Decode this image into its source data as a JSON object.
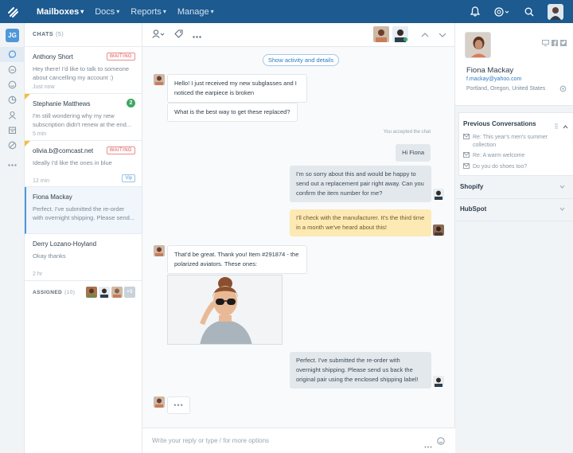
{
  "nav": {
    "items": [
      {
        "label": "Mailboxes",
        "active": true
      },
      {
        "label": "Docs",
        "active": false
      },
      {
        "label": "Reports",
        "active": false
      },
      {
        "label": "Manage",
        "active": false
      }
    ]
  },
  "rail": {
    "user_initials": "JG"
  },
  "chat_list": {
    "header": "CHATS",
    "count": "(5)",
    "chats": [
      {
        "name": "Anthony Short",
        "snippet": "Hey there! I'd like to talk to someone about cancelling my account :)",
        "time": "Just now",
        "tag": "WAITING"
      },
      {
        "name": "Stephanie Matthews",
        "snippet": "I'm still wondering why my new subscription didn't renew at the end...",
        "time": "5 min",
        "badge": "2"
      },
      {
        "name": "olivia.b@comcast.net",
        "snippet": "Ideally I'd like the ones in blue",
        "time": "12 min",
        "tag": "WAITING",
        "vip": "Vip"
      },
      {
        "name": "Fiona Mackay",
        "snippet": "Perfect. I've submitted the re-order with overnight shipping. Please send...",
        "time": ""
      },
      {
        "name": "Derry Lozano-Hoyland",
        "snippet": "Okay thanks",
        "time": "2 hr"
      }
    ],
    "assigned_label": "ASSIGNED",
    "assigned_count": "(10)",
    "assigned_more": "+5"
  },
  "conversation": {
    "activity_button": "Show activity and details",
    "accepted_line": "You accepted the chat",
    "messages": [
      {
        "from": "customer",
        "text": "Hello! I just received my new subglasses and I noticed the earpiece is broken"
      },
      {
        "from": "customer",
        "text": "What is the best way to get these replaced?"
      },
      {
        "from": "agent",
        "text": "Hi Fiona"
      },
      {
        "from": "agent",
        "text": "I'm so sorry about this and would be happy to send out a replacement pair right away. Can you confirm the item number for me?"
      },
      {
        "from": "note",
        "text": "I'll check with the manufacturer. It's the third time in a month we've heard about this!"
      },
      {
        "from": "customer",
        "text": "That'd be great. Thank you! Item #291874 - the polarized aviators. These ones:"
      },
      {
        "from": "agent",
        "text": "Perfect. I've submitted the re-order with overnight shipping. Please send us back the original pair using the enclosed shipping label!"
      }
    ],
    "typing": "•••",
    "composer_placeholder": "Write your reply or type / for more options"
  },
  "customer": {
    "name": "Fiona Mackay",
    "email": "f.mackay@yahoo.com",
    "location": "Portland, Oregon, United States"
  },
  "previous_conversations": {
    "title": "Previous Conversations",
    "items": [
      "Re: This year's men's summer collection",
      "Re: A warm welcome",
      "Do you do shoes too?"
    ]
  },
  "integrations": [
    {
      "label": "Shopify"
    },
    {
      "label": "HubSpot"
    }
  ],
  "colors": {
    "nav_bg": "#1c5a8f",
    "accent": "#4f97d9",
    "waiting": "#e04b4b",
    "note_bg": "#fde9b3",
    "badge_green": "#3aa862"
  }
}
